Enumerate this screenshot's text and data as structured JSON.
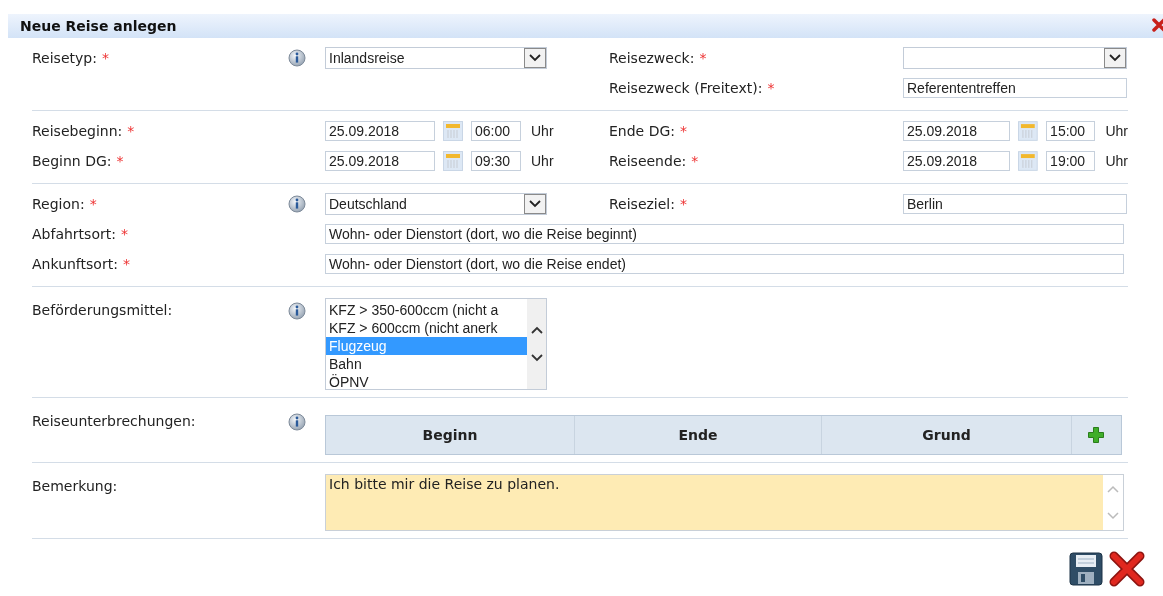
{
  "dialog": {
    "title": "Neue Reise anlegen",
    "closable": true
  },
  "sections": [
    {
      "rows": [
        {
          "left": {
            "label": "Reisetyp:",
            "mark": "*",
            "info": true,
            "field": {
              "kind": "select",
              "value": "Inlandsreise"
            }
          },
          "right": {
            "label": "Reisezweck:",
            "mark": "*",
            "field": {
              "kind": "select"
            }
          }
        },
        {
          "right": {
            "label": "Reisezweck (Freitext):",
            "mark": "*",
            "field": {
              "kind": "text",
              "value": "Referententreffen"
            }
          }
        }
      ]
    },
    {
      "rows": [
        {
          "left": {
            "label": "Reisebeginn:",
            "mark": "*",
            "info": false,
            "field": {
              "kind": "datetime",
              "date": "25.09.2018",
              "time": "06:00",
              "unit": "Uhr"
            }
          },
          "right": {
            "label": "Ende DG:",
            "mark": "*",
            "field": {
              "kind": "datetime",
              "date": "25.09.2018",
              "time": "15:00",
              "unit": "Uhr"
            }
          }
        },
        {
          "left": {
            "label": "Beginn DG:",
            "mark": "*",
            "info": false,
            "field": {
              "kind": "datetime",
              "date": "25.09.2018",
              "time": "09:30",
              "unit": "Uhr"
            }
          },
          "right": {
            "label": "Reiseende:",
            "mark": "*",
            "field": {
              "kind": "datetime",
              "date": "25.09.2018",
              "time": "19:00",
              "unit": "Uhr"
            }
          }
        }
      ]
    },
    {
      "rows": [
        {
          "left": {
            "label": "Region:",
            "mark": "*",
            "info": true,
            "field": {
              "kind": "select",
              "value": "Deutschland"
            }
          },
          "right": {
            "label": "Reiseziel:",
            "mark": "*",
            "field": {
              "kind": "text",
              "value": "Berlin"
            }
          }
        },
        {
          "wide": {
            "label": "Abfahrtsort:",
            "mark": "*",
            "info": false,
            "field": {
              "kind": "text",
              "value": "Wohn- oder Dienstort (dort, wo die Reise beginnt)"
            }
          }
        },
        {
          "wide": {
            "label": "Ankunftsort:",
            "mark": "*",
            "info": false,
            "field": {
              "kind": "text",
              "value": "Wohn- oder Dienstort (dort, wo die Reise endet)"
            }
          }
        }
      ]
    },
    {
      "rows": [
        {
          "left": {
            "label": "Beförderungsmittel:",
            "info": true,
            "field": {
              "kind": "listbox",
              "options": [
                {
                  "label": "KFZ > 350-600ccm (nicht a",
                  "selected": false
                },
                {
                  "label": "KFZ > 600ccm (nicht anerk",
                  "selected": false
                },
                {
                  "label": "Flugzeug",
                  "selected": true
                },
                {
                  "label": "Bahn",
                  "selected": false
                },
                {
                  "label": "ÖPNV",
                  "selected": false
                }
              ]
            }
          }
        }
      ]
    },
    {
      "rows": [
        {
          "wide": {
            "label": "Reiseunterbrechungen:",
            "info": true,
            "field": {
              "kind": "table",
              "columns": [
                "Beginn",
                "Ende",
                "Grund"
              ],
              "addable": true
            }
          }
        }
      ]
    },
    {
      "rows": [
        {
          "wide": {
            "label": "Bemerkung:",
            "info": false,
            "field": {
              "kind": "textarea",
              "value": "Ich bitte mir die Reise zu planen."
            }
          }
        }
      ]
    }
  ],
  "actions": [
    {
      "kind": "save"
    },
    {
      "kind": "cancel"
    }
  ]
}
